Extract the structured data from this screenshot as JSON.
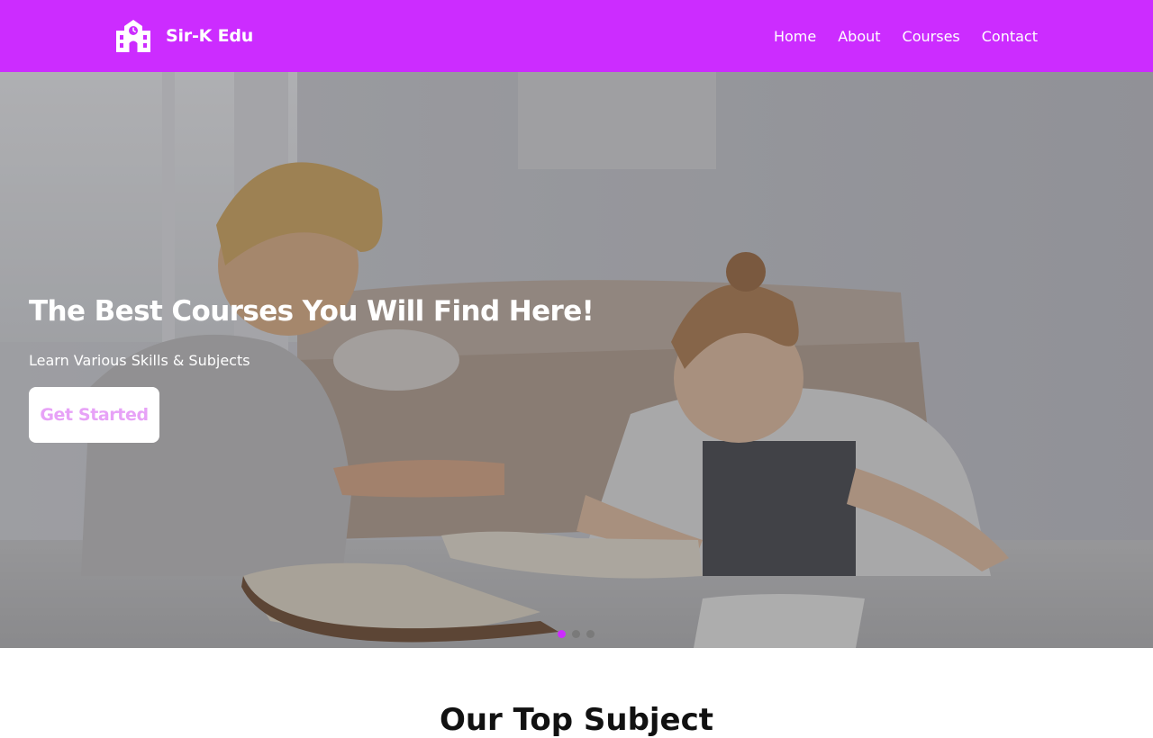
{
  "navbar": {
    "brand_name": "Sir-K Edu",
    "brand_icon": "school-icon",
    "background_color": "#cc2cff",
    "links": [
      {
        "label": "Home"
      },
      {
        "label": "About"
      },
      {
        "label": "Courses"
      },
      {
        "label": "Contact"
      }
    ]
  },
  "hero": {
    "title": "The Best Courses You Will Find Here!",
    "subtitle": "Learn Various Skills & Subjects",
    "cta_label": "Get Started",
    "cta_text_color": "#e7a2f7",
    "carousel": {
      "slide_count": 3,
      "active_index": 0,
      "active_color": "#cc2cff"
    }
  },
  "section": {
    "heading": "Our Top Subject"
  }
}
